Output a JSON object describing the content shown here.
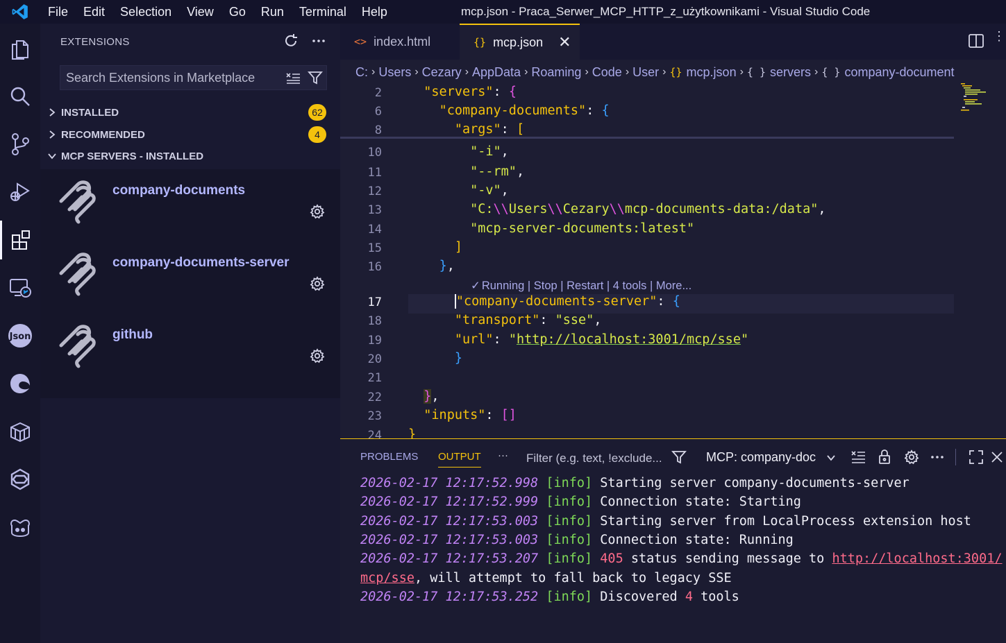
{
  "titlebar": {
    "menus": [
      "File",
      "Edit",
      "Selection",
      "View",
      "Go",
      "Run",
      "Terminal",
      "Help"
    ],
    "title": "mcp.json - Praca_Serwer_MCP_HTTP_z_użytkownikami - Visual Studio Code"
  },
  "activity_bar": {
    "icons": [
      "explorer-icon",
      "search-icon",
      "source-control-icon",
      "run-debug-icon",
      "extensions-icon",
      "remote-explorer-icon",
      "json-icon",
      "edge-icon",
      "containers-icon",
      "kubernetes-icon",
      "copilot-icon"
    ],
    "active": "extensions-icon"
  },
  "sidebar": {
    "header": "EXTENSIONS",
    "search_placeholder": "Search Extensions in Marketplace",
    "sections": [
      {
        "label": "INSTALLED",
        "badge": "62",
        "expanded": false
      },
      {
        "label": "RECOMMENDED",
        "badge": "4",
        "expanded": false
      },
      {
        "label": "MCP SERVERS - INSTALLED",
        "badge": "",
        "expanded": true
      }
    ],
    "mcp_servers": [
      {
        "name": "company-documents"
      },
      {
        "name": "company-documents-server"
      },
      {
        "name": "github"
      }
    ]
  },
  "editor": {
    "tabs": [
      {
        "label": "index.html",
        "glyph": "<>",
        "active": false
      },
      {
        "label": "mcp.json",
        "glyph": "{}",
        "active": true,
        "close": "✕"
      }
    ],
    "breadcrumb": [
      "C:",
      "Users",
      "Cezary",
      "AppData",
      "Roaming",
      "Code",
      "User",
      "mcp.json",
      "servers",
      "company-document"
    ],
    "breadcrumb_glyphs": {
      "file": "{}",
      "obj": "{ }"
    },
    "sticky_lines": [
      {
        "ln": "2",
        "indent": "  ",
        "key": "\"servers\"",
        "rest": ": ",
        "open": "{"
      },
      {
        "ln": "6",
        "indent": "    ",
        "key": "\"company-documents\"",
        "rest": ": ",
        "open": "{"
      },
      {
        "ln": "8",
        "indent": "      ",
        "key": "\"args\"",
        "rest": ": ",
        "open": "["
      }
    ],
    "lines": {
      "l10": {
        "ln": "10",
        "text": "\"-i\"",
        "comma": ","
      },
      "l11": {
        "ln": "11",
        "text": "\"--rm\"",
        "comma": ","
      },
      "l12": {
        "ln": "12",
        "text": "\"-v\"",
        "comma": ","
      },
      "l13": {
        "ln": "13",
        "pre": "\"C:",
        "esc1": "\\\\",
        "mid1": "Users",
        "esc2": "\\\\",
        "mid2": "Cezary",
        "esc3": "\\\\",
        "post": "mcp-documents-data:/data\"",
        "comma": ","
      },
      "l14": {
        "ln": "14",
        "text": "\"mcp-server-documents:latest\""
      },
      "l15": {
        "ln": "15",
        "text": "]"
      },
      "l16": {
        "ln": "16",
        "text": "}",
        "comma": ","
      },
      "l17": {
        "ln": "17",
        "key": "\"company-documents-server\"",
        "rest": ": ",
        "open": "{"
      },
      "l18": {
        "ln": "18",
        "key": "\"transport\"",
        "rest": ": ",
        "val": "\"sse\"",
        "comma": ","
      },
      "l19": {
        "ln": "19",
        "key": "\"url\"",
        "rest": ": ",
        "q1": "\"",
        "val": "http://localhost:3001/mcp/sse",
        "q2": "\""
      },
      "l20": {
        "ln": "20",
        "text": "}"
      },
      "l21": {
        "ln": "21"
      },
      "l22": {
        "ln": "22",
        "text": "}",
        "comma": ","
      },
      "l23": {
        "ln": "23",
        "key": "\"inputs\"",
        "rest": ": ",
        "val": "[]"
      },
      "l24": {
        "ln": "24",
        "text": "}"
      }
    },
    "codelens": {
      "check": "✓",
      "text": "Running | Stop | Restart | 4 tools | More..."
    }
  },
  "panel": {
    "tabs": [
      "PROBLEMS",
      "OUTPUT"
    ],
    "active_tab": "OUTPUT",
    "more": "···",
    "filter_placeholder": "Filter (e.g. text, !exclude...",
    "channel": "MCP: company-doc",
    "log": [
      {
        "ts": "2026-02-17 12:17:52.998",
        "level": "[info]",
        "msg": "Starting server company-documents-server"
      },
      {
        "ts": "2026-02-17 12:17:52.999",
        "level": "[info]",
        "msg": "Connection state: Starting"
      },
      {
        "ts": "2026-02-17 12:17:53.003",
        "level": "[info]",
        "msg": "Starting server from LocalProcess extension host"
      },
      {
        "ts": "2026-02-17 12:17:53.003",
        "level": "[info]",
        "msg": "Connection state: Running"
      },
      {
        "ts": "2026-02-17 12:17:53.207",
        "level": "[info]",
        "code": "405",
        "msg": " status sending message to ",
        "url1": "http://localhost:3001/",
        "url2": "mcp/sse",
        "msg2": ", will attempt to fall back to legacy SSE"
      },
      {
        "ts": "2026-02-17 12:17:53.252",
        "level": "[info]",
        "msg_a": "Discovered ",
        "count": "4",
        "msg_b": " tools"
      }
    ]
  },
  "colors": {
    "accent": "#f4c20d",
    "link": "#a9a9e8",
    "background": "#1d1d33"
  }
}
